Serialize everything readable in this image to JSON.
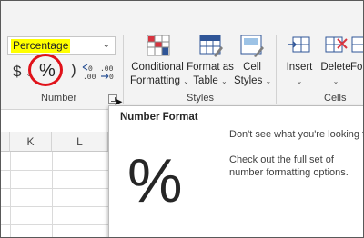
{
  "number_group": {
    "format_value": "Percentage",
    "currency_symbol": "$",
    "percent_symbol": "%",
    "comma_symbol": ")",
    "increase_decimal": "←0\n.00",
    "decrease_decimal": ".00\n→.0",
    "label": "Number"
  },
  "styles_group": {
    "conditional_formatting": [
      "Conditional",
      "Formatting"
    ],
    "format_as_table": [
      "Format as",
      "Table"
    ],
    "cell_styles": [
      "Cell",
      "Styles"
    ],
    "label": "Styles"
  },
  "cells_group": {
    "insert": "Insert",
    "delete": "Delete",
    "format_partial": "Fo",
    "label": "Cells"
  },
  "sheet": {
    "columns": [
      "K",
      "L"
    ]
  },
  "tooltip": {
    "title": "Number Format",
    "question": "Don't see what you're looking for?",
    "description": "Check out the full set of number formatting options.",
    "glyph": "%"
  },
  "colors": {
    "highlight": "#ffff00",
    "annotation_circle": "#e0121a",
    "accent_blue": "#2f5597",
    "table_red": "#d8343f"
  }
}
